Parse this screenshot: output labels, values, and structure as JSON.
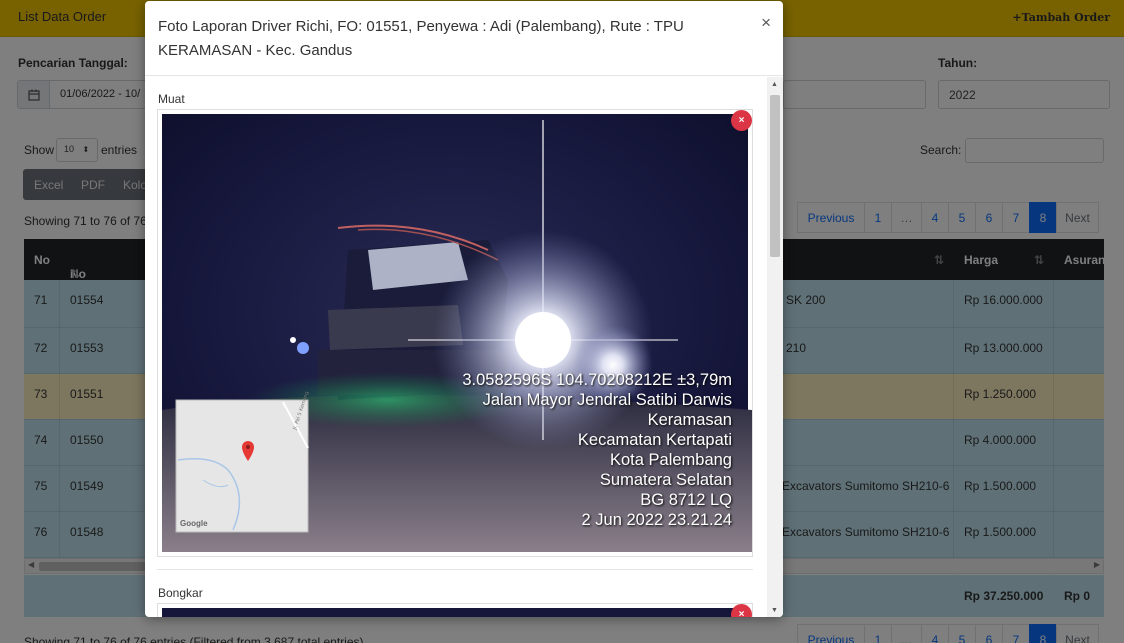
{
  "page": {
    "title": "List Data Order",
    "add_button": "Tambah Order",
    "date_label": "Pencarian Tanggal:",
    "date_value": "01/06/2022 - 10/",
    "year_label": "Tahun:",
    "year_value": "2022",
    "show_label": "Show",
    "entries_value": "10",
    "entries_label": "entries",
    "export_buttons": [
      "Excel",
      "PDF",
      "Kolo"
    ],
    "search_label": "Search:",
    "showing_text": "Showing 71 to 76 of 76",
    "showing_bottom": "Showing 71 to 76 of 76 entries (Filtered from 3,687 total entries)"
  },
  "pagination": [
    "Previous",
    "1",
    "…",
    "4",
    "5",
    "6",
    "7",
    "8",
    "Next"
  ],
  "table": {
    "headers": [
      "No",
      "No Order",
      "Harga",
      "Asuran"
    ],
    "rows": [
      {
        "no": "71",
        "order": "01554",
        "unit": "SK 200",
        "harga": "Rp 16.000.000"
      },
      {
        "no": "72",
        "order": "01553",
        "unit": "210",
        "harga": "Rp 13.000.000"
      },
      {
        "no": "73",
        "order": "01551",
        "unit": "",
        "harga": "Rp 1.250.000"
      },
      {
        "no": "74",
        "order": "01550",
        "unit": "",
        "harga": "Rp 4.000.000"
      },
      {
        "no": "75",
        "order": "01549",
        "unit": "Excavators Sumitomo SH210-6",
        "harga": "Rp 1.500.000"
      },
      {
        "no": "76",
        "order": "01548",
        "unit": "Excavators Sumitomo SH210-6",
        "harga": "Rp 1.500.000"
      }
    ],
    "footer_total": "Rp 37.250.000",
    "footer_asuransi": "Rp 0"
  },
  "modal": {
    "title": "Foto Laporan Driver Richi, FO: 01551, Penyewa : Adi (Palembang), Rute : TPU KERAMASAN - Kec. Gandus",
    "close": "×",
    "section_muat": "Muat",
    "section_bongkar": "Bongkar",
    "delete_symbol": "×",
    "photo_overlay": [
      "3.0582596S 104.70208212E ±3,79m",
      "Jalan Mayor Jendral Satibi Darwis",
      "Keramasan",
      "Kecamatan Kertapati",
      "Kota Palembang",
      "Sumatera Selatan",
      "BG 8712 LQ",
      "2 Jun 2022 23.21.24"
    ],
    "map_road_label": "Jl. Pal 5 Kemang",
    "map_brand": "Google"
  },
  "colors": {
    "topbar": "#f0c400",
    "row_bg": "#bfe3ef",
    "row_highlight": "#fbeebe",
    "active_page": "#0d6efd",
    "delete_button": "#dc3545"
  }
}
